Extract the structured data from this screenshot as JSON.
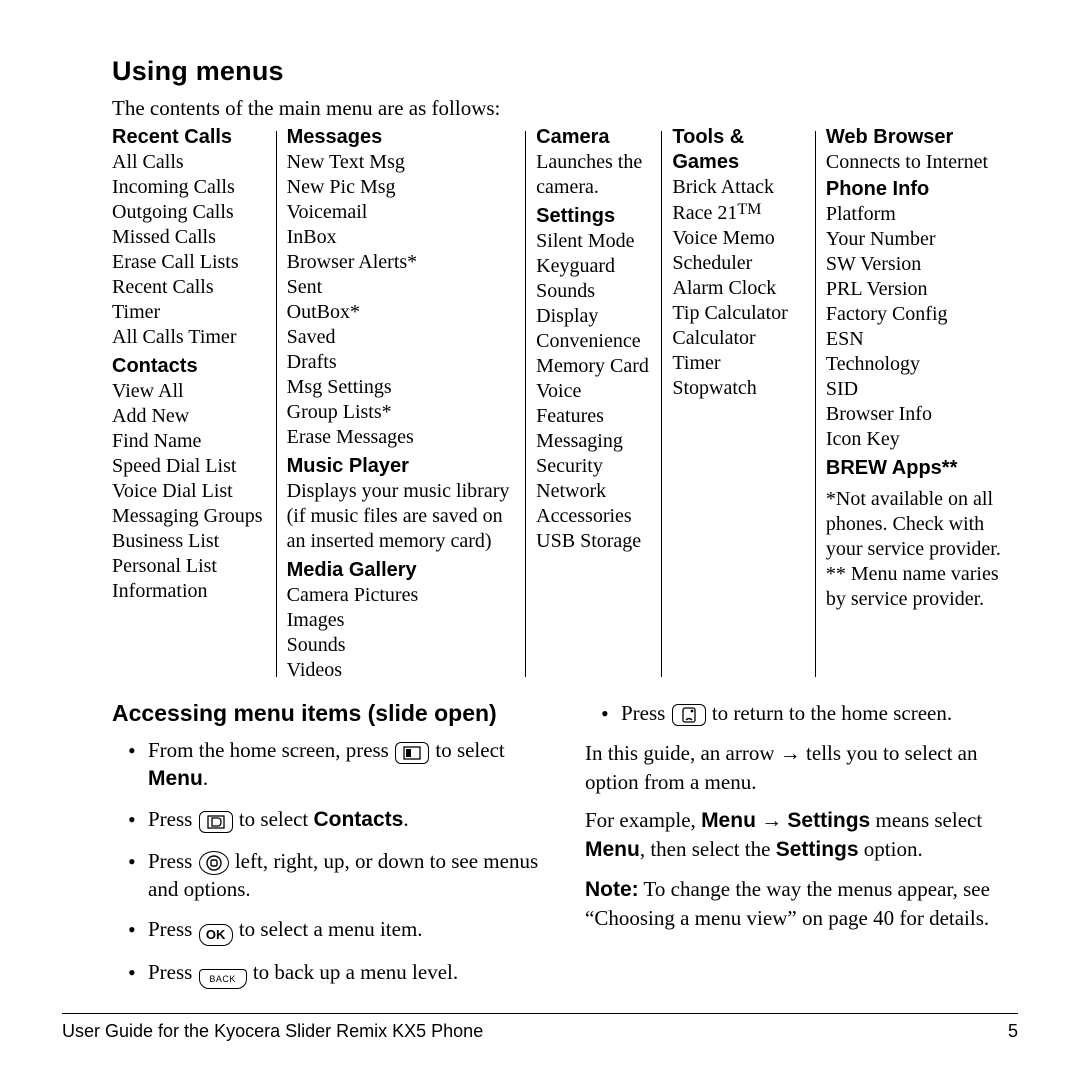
{
  "title": "Using menus",
  "intro": "The contents of the main menu are as follows:",
  "columns": {
    "col1": {
      "recent_calls": {
        "label": "Recent Calls",
        "items": [
          "All Calls",
          "Incoming Calls",
          "Outgoing Calls",
          "Missed Calls",
          "Erase Call Lists",
          "Recent Calls Timer",
          "All Calls Timer"
        ]
      },
      "contacts": {
        "label": "Contacts",
        "items": [
          "View All",
          "Add New",
          "Find Name",
          "Speed Dial List",
          "Voice Dial List",
          "Messaging Groups",
          "Business List",
          "Personal List",
          "Information"
        ]
      }
    },
    "col2": {
      "messages": {
        "label": "Messages",
        "items": [
          "New Text Msg",
          "New Pic Msg",
          "Voicemail",
          "InBox",
          "Browser Alerts*",
          "Sent",
          "OutBox*",
          "Saved",
          "Drafts",
          "Msg Settings",
          "Group Lists*",
          "Erase Messages"
        ]
      },
      "music_player": {
        "label": "Music Player",
        "desc": "Displays your music library (if music files are saved on an inserted memory card)"
      },
      "media_gallery": {
        "label": "Media Gallery",
        "items": [
          "Camera Pictures",
          "Images",
          "Sounds",
          "Videos"
        ]
      }
    },
    "col3": {
      "camera": {
        "label": "Camera",
        "desc": "Launches the camera."
      },
      "settings": {
        "label": "Settings",
        "items": [
          "Silent Mode",
          "Keyguard",
          "Sounds",
          "Display",
          "Convenience",
          "Memory Card",
          "Voice Features",
          "Messaging",
          "Security",
          "Network",
          "Accessories",
          "USB Storage"
        ]
      }
    },
    "col4": {
      "tools": {
        "label": "Tools & Games",
        "items_pre": "Brick Attack",
        "race21_base": "Race 21",
        "race21_tm": "TM",
        "items_post": [
          "Voice Memo",
          "Scheduler",
          "Alarm Clock",
          "Tip Calculator",
          "Calculator",
          "Timer",
          "Stopwatch"
        ]
      }
    },
    "col5": {
      "web": {
        "label": "Web Browser",
        "desc": "Connects to Internet"
      },
      "phone_info": {
        "label": "Phone Info",
        "items": [
          "Platform",
          "Your Number",
          "SW Version",
          "PRL Version",
          "Factory Config",
          "ESN",
          "Technology",
          "SID",
          "Browser Info",
          "Icon Key"
        ]
      },
      "brew": {
        "label": "BREW Apps**"
      },
      "foot1": "*Not available on all phones. Check with your service provider.",
      "foot2": "** Menu name varies by service provider."
    }
  },
  "subheading": "Accessing menu items (slide open)",
  "bullets": {
    "b1_pre": "From the home screen, press ",
    "b1_post": " to select ",
    "b1_bold": "Menu",
    "b1_end": ".",
    "b2_pre": "Press ",
    "b2_post": " to select ",
    "b2_bold": "Contacts",
    "b2_end": ".",
    "b3_pre": "Press ",
    "b3_post": "  left, right, up, or down to see menus and options.",
    "b4_pre": "Press ",
    "b4_post": " to select a menu item.",
    "b5_pre": "Press ",
    "b5_post": " to back up a menu level.",
    "b6_pre": "Press ",
    "b6_post": " to return to the home screen."
  },
  "right_paras": {
    "p1_pre": "In this guide, an arrow ",
    "p1_post": " tells you to select an option from a menu.",
    "p2_pre": "For example, ",
    "p2_menu": "Menu",
    "p2_mid": " ",
    "p2_settings": "Settings",
    "p2_post": " means select ",
    "p2_menu2": "Menu",
    "p2_then": ", then select the ",
    "p2_settings2": "Settings",
    "p2_end": " option.",
    "note_label": "Note:",
    "note_text": "  To change the way the menus appear, see “Choosing a menu view” on page 40 for details."
  },
  "arrow": "→",
  "key_labels": {
    "ok": "OK",
    "back": "BACK"
  },
  "footer": {
    "left": "User Guide for the Kyocera Slider Remix KX5 Phone",
    "right": "5"
  }
}
